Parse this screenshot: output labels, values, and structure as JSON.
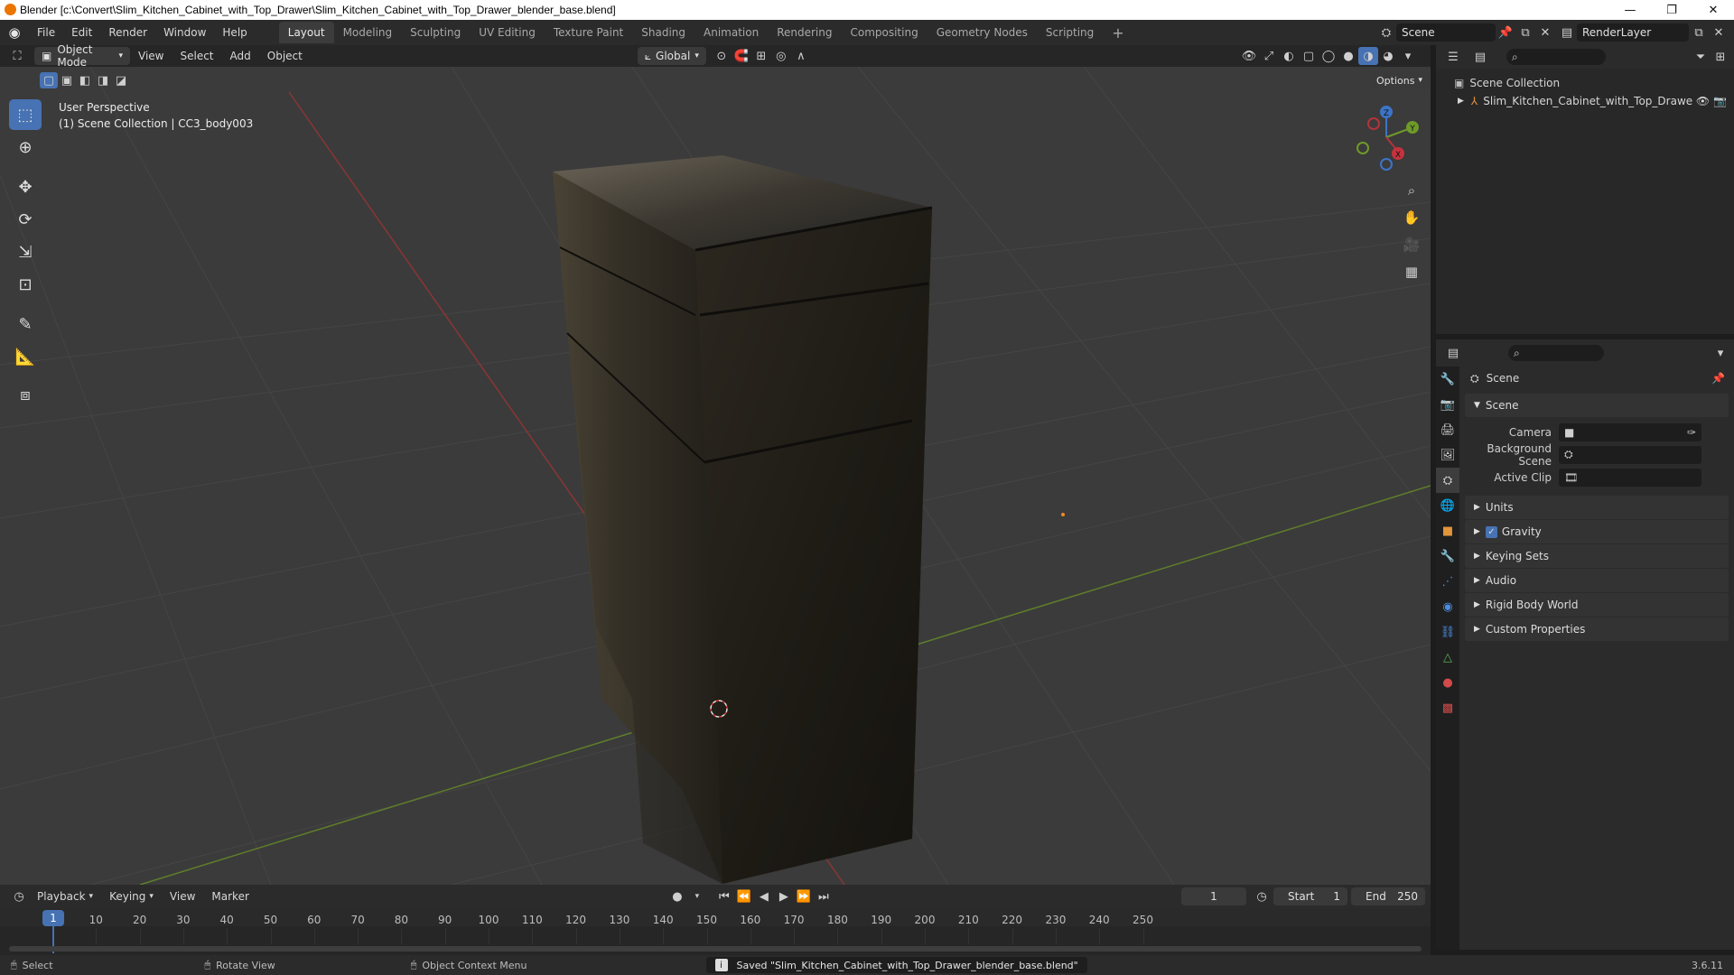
{
  "window": {
    "title": "Blender [c:\\Convert\\Slim_Kitchen_Cabinet_with_Top_Drawer\\Slim_Kitchen_Cabinet_with_Top_Drawer_blender_base.blend]",
    "minimize": "—",
    "maximize": "❐",
    "close": "✕"
  },
  "menu": [
    "File",
    "Edit",
    "Render",
    "Window",
    "Help"
  ],
  "workspaces": [
    "Layout",
    "Modeling",
    "Sculpting",
    "UV Editing",
    "Texture Paint",
    "Shading",
    "Animation",
    "Rendering",
    "Compositing",
    "Geometry Nodes",
    "Scripting"
  ],
  "active_workspace": "Layout",
  "scene_name": "Scene",
  "view_layer": "RenderLayer",
  "viewport": {
    "mode": "Object Mode",
    "menus": [
      "View",
      "Select",
      "Add",
      "Object"
    ],
    "orientation": "Global",
    "options_label": "Options",
    "overlay_line1": "User Perspective",
    "overlay_line2": "(1) Scene Collection | CC3_body003",
    "gizmo_axes": {
      "x": "X",
      "y": "Y",
      "z": "Z"
    }
  },
  "outliner": {
    "root": "Scene Collection",
    "item": "Slim_Kitchen_Cabinet_with_Top_Drawe"
  },
  "properties": {
    "header": "Scene",
    "section": "Scene",
    "fields": [
      {
        "label": "Camera",
        "value": ""
      },
      {
        "label": "Background Scene",
        "value": ""
      },
      {
        "label": "Active Clip",
        "value": ""
      }
    ],
    "panels": [
      "Units",
      "Gravity",
      "Keying Sets",
      "Audio",
      "Rigid Body World",
      "Custom Properties"
    ],
    "gravity_checked": true
  },
  "timeline": {
    "menus": [
      "Playback",
      "Keying",
      "View",
      "Marker"
    ],
    "current_frame": "1",
    "start_label": "Start",
    "start": "1",
    "end_label": "End",
    "end": "250",
    "ticks": [
      "1",
      "10",
      "20",
      "30",
      "40",
      "50",
      "60",
      "70",
      "80",
      "90",
      "100",
      "110",
      "120",
      "130",
      "140",
      "150",
      "160",
      "170",
      "180",
      "190",
      "200",
      "210",
      "220",
      "230",
      "240",
      "250"
    ]
  },
  "status": {
    "select": "Select",
    "rotate": "Rotate View",
    "context": "Object Context Menu",
    "message": "Saved \"Slim_Kitchen_Cabinet_with_Top_Drawer_blender_base.blend\"",
    "version": "3.6.11"
  },
  "colors": {
    "accent": "#4772b3",
    "x_axis": "#b5323a",
    "y_axis": "#6e9a2a",
    "z_axis": "#3d74c7",
    "viewport_bg": "#3b3b3b"
  }
}
